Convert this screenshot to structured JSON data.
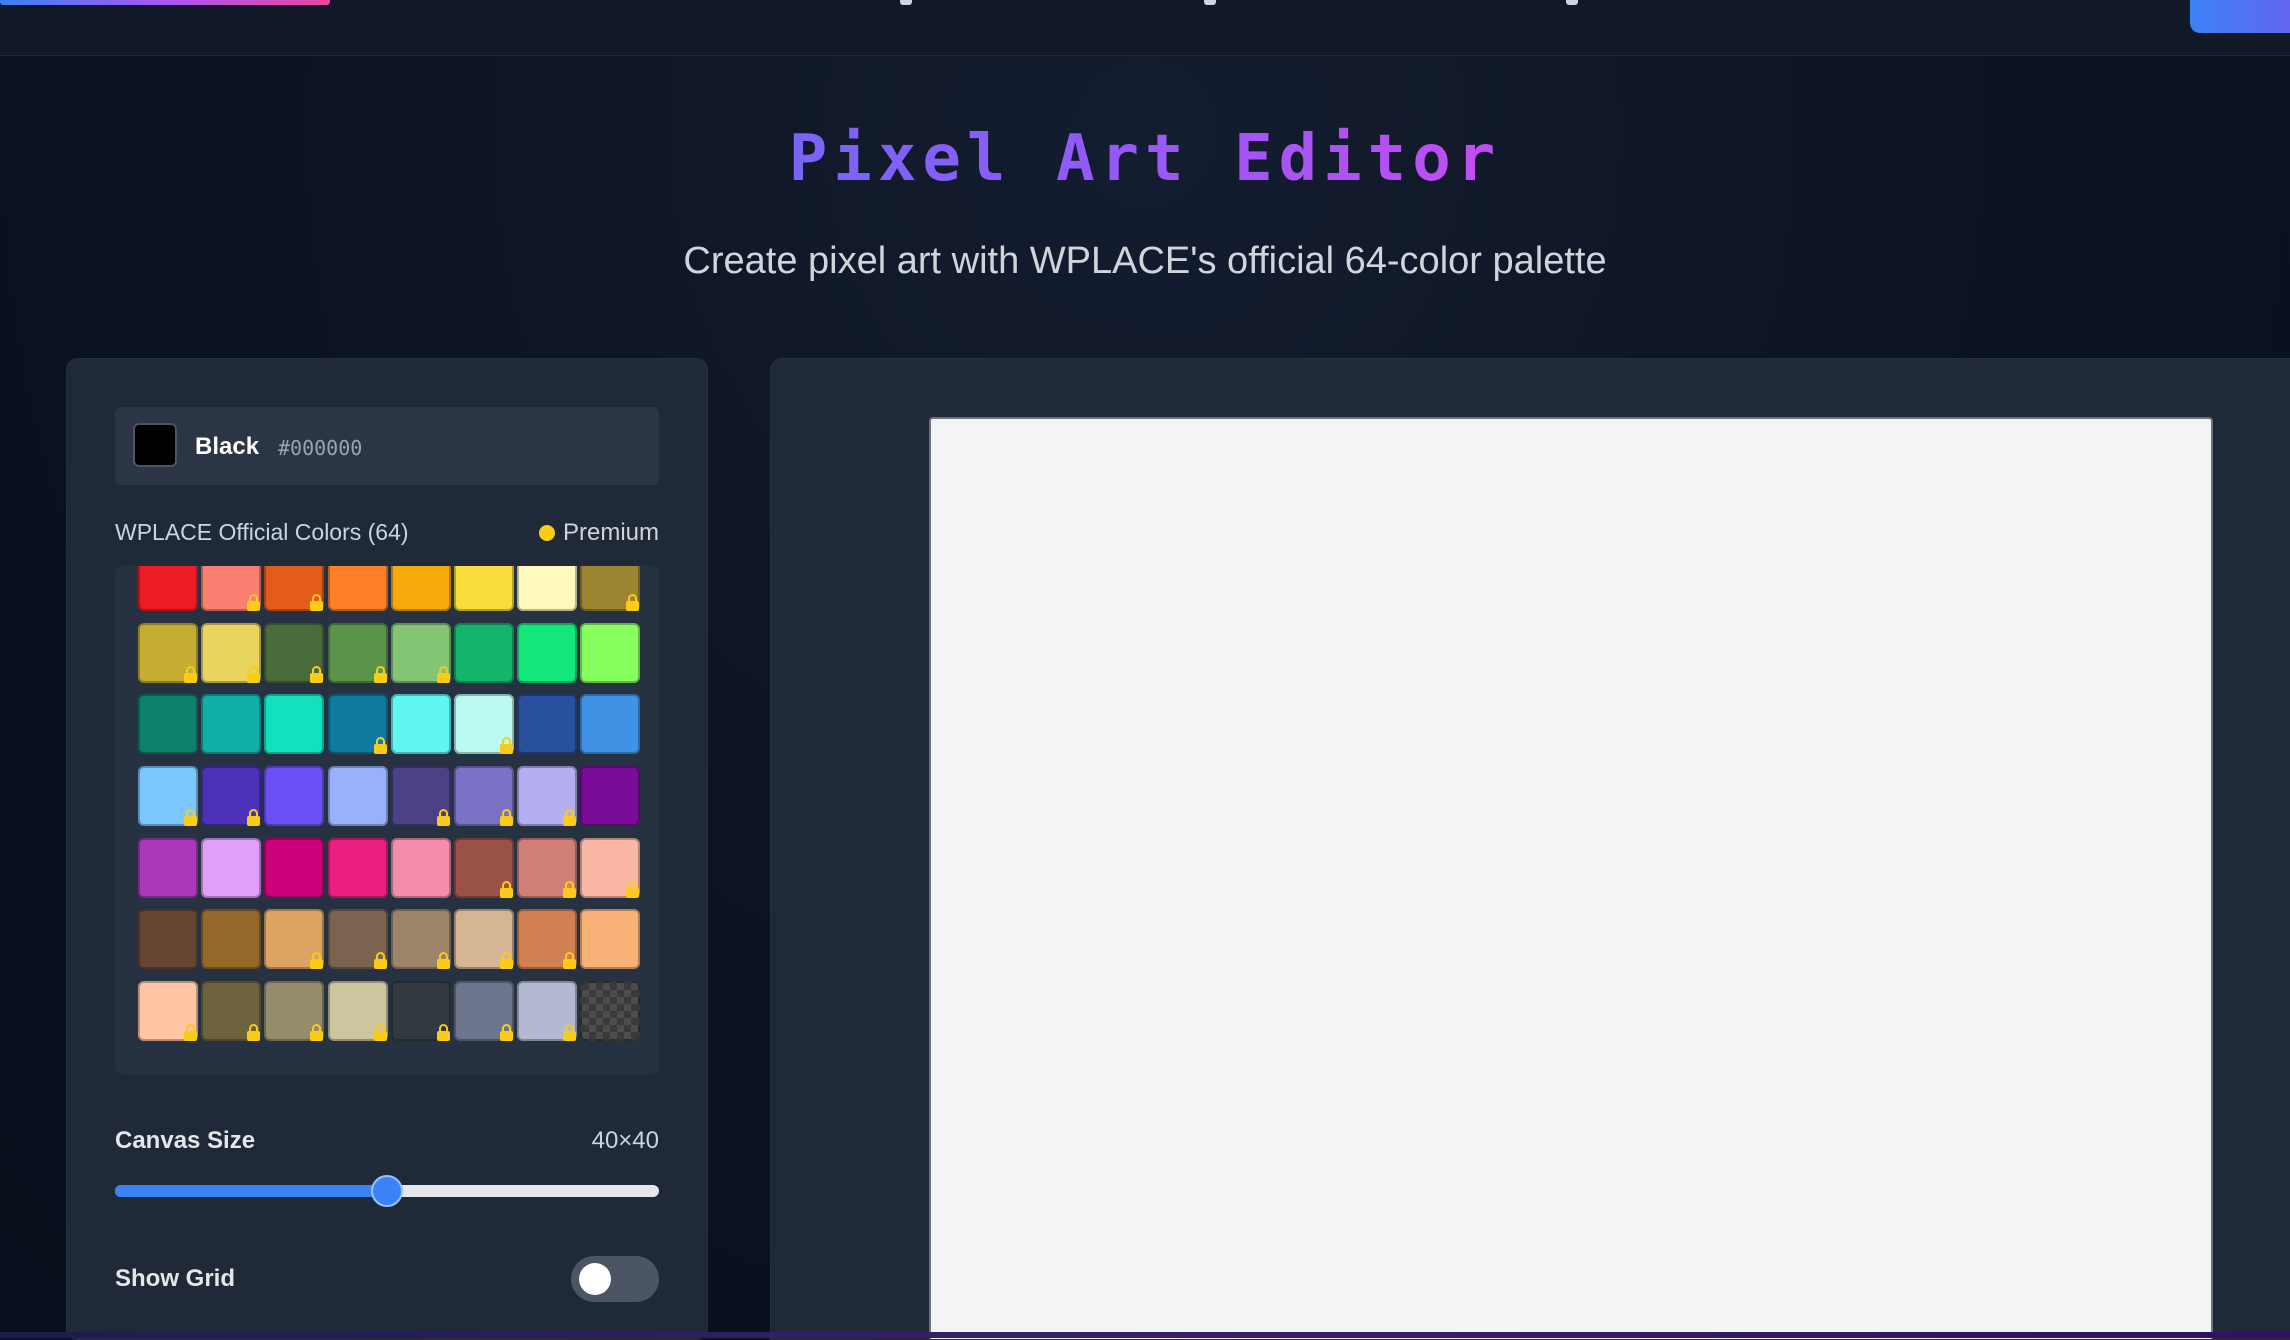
{
  "header": {
    "title": "Pixel Art Editor",
    "subtitle": "Create pixel art with WPLACE's official 64-color palette"
  },
  "selected_color": {
    "name": "Black",
    "hex": "#000000"
  },
  "palette": {
    "label": "WPLACE Official Colors (64)",
    "premium_label": "Premium",
    "premium_color": "#facc15",
    "colors": [
      {
        "hex": "#ed1c24",
        "locked": false
      },
      {
        "hex": "#fa8072",
        "locked": true
      },
      {
        "hex": "#e45c1a",
        "locked": true
      },
      {
        "hex": "#ff7f27",
        "locked": false
      },
      {
        "hex": "#f6aa09",
        "locked": false
      },
      {
        "hex": "#f9dd3b",
        "locked": false
      },
      {
        "hex": "#fffabc",
        "locked": false
      },
      {
        "hex": "#9c8431",
        "locked": true
      },
      {
        "hex": "#c5ad31",
        "locked": true
      },
      {
        "hex": "#e8d45f",
        "locked": true
      },
      {
        "hex": "#4a6b3a",
        "locked": true
      },
      {
        "hex": "#5a944a",
        "locked": true
      },
      {
        "hex": "#84c573",
        "locked": true
      },
      {
        "hex": "#13b46b",
        "locked": false
      },
      {
        "hex": "#13e67b",
        "locked": false
      },
      {
        "hex": "#87ff5e",
        "locked": false
      },
      {
        "hex": "#0c816e",
        "locked": false
      },
      {
        "hex": "#10aea6",
        "locked": false
      },
      {
        "hex": "#13e1be",
        "locked": false
      },
      {
        "hex": "#0f799f",
        "locked": true
      },
      {
        "hex": "#60f7f2",
        "locked": false
      },
      {
        "hex": "#bbfaf2",
        "locked": true
      },
      {
        "hex": "#28509e",
        "locked": false
      },
      {
        "hex": "#4093e4",
        "locked": false
      },
      {
        "hex": "#7dc7ff",
        "locked": true
      },
      {
        "hex": "#4d31b8",
        "locked": true
      },
      {
        "hex": "#6b50f6",
        "locked": false
      },
      {
        "hex": "#99b1fb",
        "locked": false
      },
      {
        "hex": "#4a4284",
        "locked": true
      },
      {
        "hex": "#7a71c4",
        "locked": true
      },
      {
        "hex": "#b5aef1",
        "locked": true
      },
      {
        "hex": "#780c99",
        "locked": false
      },
      {
        "hex": "#aa38b9",
        "locked": false
      },
      {
        "hex": "#e09ff9",
        "locked": false
      },
      {
        "hex": "#cb007a",
        "locked": false
      },
      {
        "hex": "#ec1f80",
        "locked": false
      },
      {
        "hex": "#f38da9",
        "locked": false
      },
      {
        "hex": "#9b5249",
        "locked": true
      },
      {
        "hex": "#d18078",
        "locked": true
      },
      {
        "hex": "#fab6a4",
        "locked": true
      },
      {
        "hex": "#684634",
        "locked": false
      },
      {
        "hex": "#95682a",
        "locked": false
      },
      {
        "hex": "#dba463",
        "locked": true
      },
      {
        "hex": "#7b6352",
        "locked": true
      },
      {
        "hex": "#9c846b",
        "locked": true
      },
      {
        "hex": "#d6b594",
        "locked": true
      },
      {
        "hex": "#d18051",
        "locked": true
      },
      {
        "hex": "#f8b277",
        "locked": false
      },
      {
        "hex": "#ffc5a5",
        "locked": true
      },
      {
        "hex": "#6d643f",
        "locked": true
      },
      {
        "hex": "#948c6b",
        "locked": true
      },
      {
        "hex": "#cdc59e",
        "locked": true
      },
      {
        "hex": "#333941",
        "locked": true
      },
      {
        "hex": "#6d758d",
        "locked": true
      },
      {
        "hex": "#b3b9d1",
        "locked": true
      },
      {
        "hex": "transparent",
        "locked": false
      }
    ]
  },
  "canvas_size": {
    "label": "Canvas Size",
    "value": "40×40",
    "slider_level": 0.5
  },
  "grid": {
    "label": "Show Grid",
    "enabled": false
  },
  "colors": {
    "accent": "#3b82f6",
    "panel": "#1f2937",
    "canvas": "#f3f4f6"
  }
}
